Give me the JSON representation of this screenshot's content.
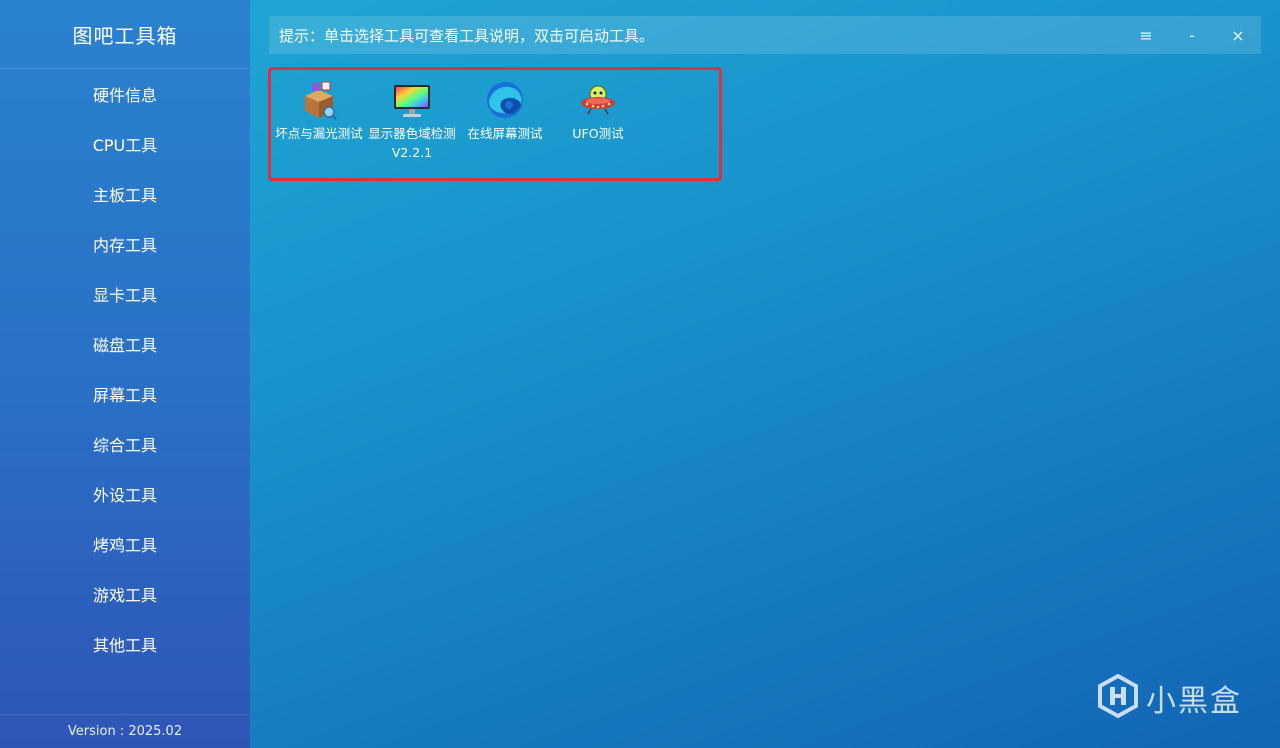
{
  "app": {
    "title": "图吧工具箱",
    "version": "Version : 2025.02"
  },
  "sidebar": {
    "items": [
      {
        "label": "硬件信息"
      },
      {
        "label": "CPU工具"
      },
      {
        "label": "主板工具"
      },
      {
        "label": "内存工具"
      },
      {
        "label": "显卡工具"
      },
      {
        "label": "磁盘工具"
      },
      {
        "label": "屏幕工具"
      },
      {
        "label": "综合工具"
      },
      {
        "label": "外设工具"
      },
      {
        "label": "烤鸡工具"
      },
      {
        "label": "游戏工具"
      },
      {
        "label": "其他工具"
      }
    ]
  },
  "hint": {
    "text": "提示：单击选择工具可查看工具说明，双击可启动工具。"
  },
  "window_controls": {
    "menu": "≡",
    "minimize": "-",
    "close": "×"
  },
  "tools": [
    {
      "label": "坏点与漏光测试",
      "icon": "package-box-icon"
    },
    {
      "label": "显示器色域检测V2.2.1",
      "icon": "color-monitor-icon"
    },
    {
      "label": "在线屏幕测试",
      "icon": "edge-browser-icon"
    },
    {
      "label": "UFO测试",
      "icon": "ufo-icon"
    }
  ],
  "watermark": {
    "text": "小黑盒",
    "icon": "heybox-logo-icon"
  },
  "colors": {
    "highlight_border": "#e0303a",
    "sidebar_top": "#2a82cf",
    "background_accent": "#1fa9d4"
  }
}
